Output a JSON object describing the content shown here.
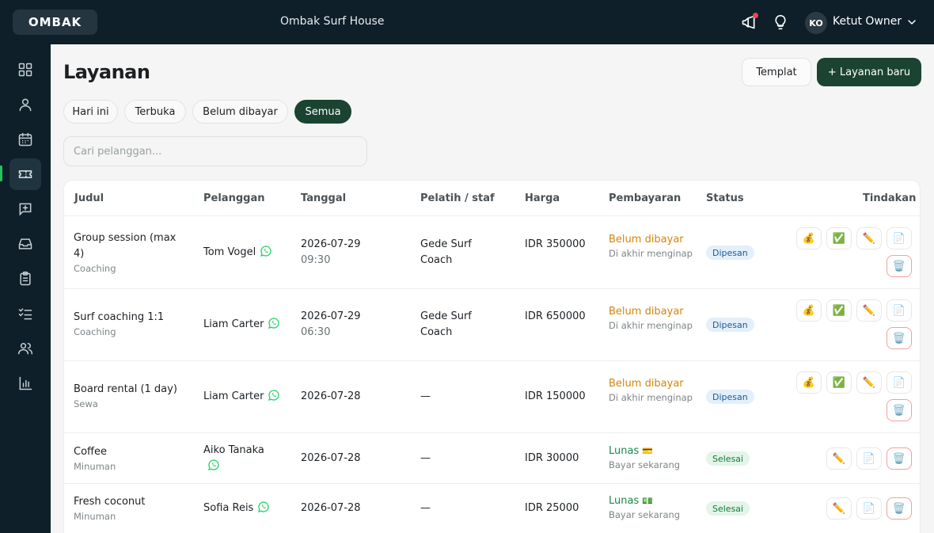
{
  "header": {
    "logo": "OMBAK",
    "business_name": "Ombak Surf House",
    "user_initials": "KO",
    "user_name": "Ketut Owner"
  },
  "sidebar": {
    "items": [
      {
        "icon": "dashboard-icon"
      },
      {
        "icon": "user-icon"
      },
      {
        "icon": "calendar-icon"
      },
      {
        "icon": "ticket-icon",
        "active": true
      },
      {
        "icon": "message-plus-icon"
      },
      {
        "icon": "inbox-icon"
      },
      {
        "icon": "clipboard-icon"
      },
      {
        "icon": "checklist-icon"
      },
      {
        "icon": "users-icon"
      },
      {
        "icon": "bar-chart-icon"
      }
    ]
  },
  "page": {
    "title": "Layanan",
    "template_button": "Templat",
    "new_button": "+ Layanan baru",
    "filters": [
      "Hari ini",
      "Terbuka",
      "Belum dibayar",
      "Semua"
    ],
    "active_filter": "Semua",
    "search_placeholder": "Cari pelanggan..."
  },
  "table": {
    "columns": [
      "Judul",
      "Pelanggan",
      "Tanggal",
      "Pelatih / staf",
      "Harga",
      "Pembayaran",
      "Status",
      "Tindakan"
    ],
    "rows": [
      {
        "title": "Group session (max 4)",
        "category": "Coaching",
        "customer": "Tom Vogel",
        "date": "2026-07-29",
        "time": "09:30",
        "staff": "Gede Surf Coach",
        "price": "IDR 350000",
        "payment": "Belum dibayar",
        "payment_note": "Di akhir menginap",
        "status": "Dipesan"
      },
      {
        "title": "Surf coaching 1:1",
        "category": "Coaching",
        "customer": "Liam Carter",
        "date": "2026-07-29",
        "time": "06:30",
        "staff": "Gede Surf Coach",
        "price": "IDR 650000",
        "payment": "Belum dibayar",
        "payment_note": "Di akhir menginap",
        "status": "Dipesan"
      },
      {
        "title": "Board rental (1 day)",
        "category": "Sewa",
        "customer": "Liam Carter",
        "date": "2026-07-28",
        "time": "",
        "staff": "—",
        "price": "IDR 150000",
        "payment": "Belum dibayar",
        "payment_note": "Di akhir menginap",
        "status": "Dipesan"
      },
      {
        "title": "Coffee",
        "category": "Minuman",
        "customer": "Aiko Tanaka",
        "date": "2026-07-28",
        "time": "",
        "staff": "—",
        "price": "IDR 30000",
        "payment": "Lunas",
        "payment_mark": "💳",
        "payment_note": "Bayar sekarang",
        "status": "Selesai"
      },
      {
        "title": "Fresh coconut",
        "category": "Minuman",
        "customer": "Sofia Reis",
        "date": "2026-07-28",
        "time": "",
        "staff": "—",
        "price": "IDR 25000",
        "payment": "Lunas",
        "payment_mark": "💵",
        "payment_note": "Bayar sekarang",
        "status": "Selesai"
      }
    ],
    "actions": {
      "charge": "💰",
      "complete": "✅",
      "edit": "✏️",
      "receipt": "📄",
      "delete": "🗑️"
    }
  },
  "colors": {
    "sidebar_bg": "#0f1f2a",
    "primary": "#1b4332",
    "unpaid": "#d4860b",
    "paid": "#1a8a4a",
    "whatsapp": "#25d366"
  }
}
